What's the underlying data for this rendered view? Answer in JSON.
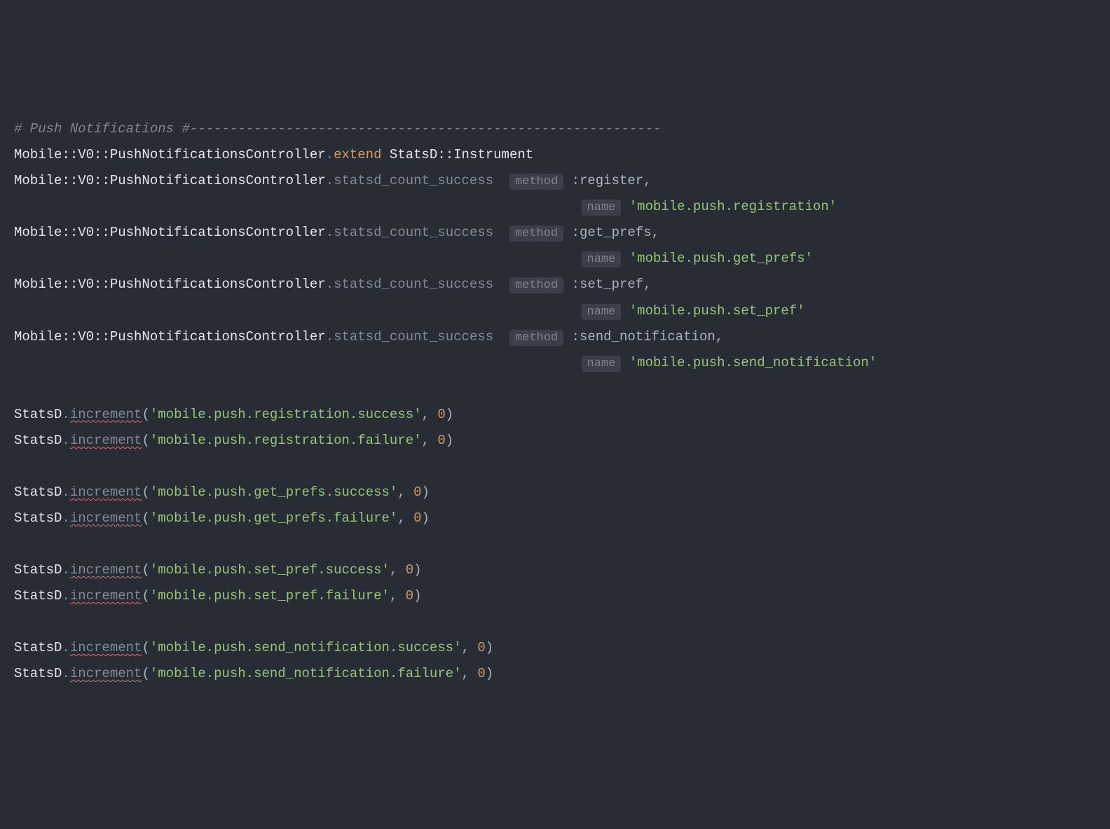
{
  "comment": "# Push Notifications #-----------------------------------------------------------",
  "controller_path": "Mobile::V0::PushNotificationsController",
  "extend_kw": "extend",
  "instrument_path": "StatsD::Instrument",
  "statsd_method": "statsd_count_success",
  "tag_method": "method",
  "tag_name": "name",
  "calls": [
    {
      "method_sym": ":register",
      "name_str": "'mobile.push.registration'"
    },
    {
      "method_sym": ":get_prefs",
      "name_str": "'mobile.push.get_prefs'"
    },
    {
      "method_sym": ":set_pref",
      "name_str": "'mobile.push.set_pref'"
    },
    {
      "method_sym": ":send_notification",
      "name_str": "'mobile.push.send_notification'"
    }
  ],
  "statsd_class": "StatsD",
  "increment_method": "increment",
  "increment_calls": [
    {
      "str": "'mobile.push.registration.success'",
      "num": "0"
    },
    {
      "str": "'mobile.push.registration.failure'",
      "num": "0"
    },
    {
      "str": "'mobile.push.get_prefs.success'",
      "num": "0"
    },
    {
      "str": "'mobile.push.get_prefs.failure'",
      "num": "0"
    },
    {
      "str": "'mobile.push.set_pref.success'",
      "num": "0"
    },
    {
      "str": "'mobile.push.set_pref.failure'",
      "num": "0"
    },
    {
      "str": "'mobile.push.send_notification.success'",
      "num": "0"
    },
    {
      "str": "'mobile.push.send_notification.failure'",
      "num": "0"
    }
  ]
}
